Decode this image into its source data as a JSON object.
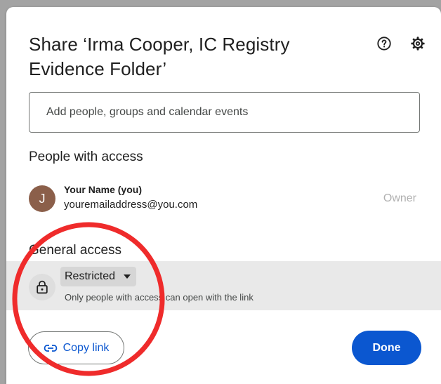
{
  "dialog": {
    "title": "Share ‘Irma Cooper, IC Registry Evidence Folder’",
    "help_icon": "help-circle-icon",
    "settings_icon": "gear-icon"
  },
  "add_people": {
    "placeholder": "Add people, groups and calendar events"
  },
  "people_with_access": {
    "heading": "People with access",
    "people": [
      {
        "avatar_letter": "J",
        "name": "Your Name (you)",
        "email": "youremailaddress@you.com",
        "role": "Owner"
      }
    ]
  },
  "general_access": {
    "heading": "General access",
    "lock_icon": "lock-icon",
    "selected": "Restricted",
    "description": "Only people with access can open with the link"
  },
  "footer": {
    "copy_link_label": "Copy link",
    "copy_link_icon": "link-icon",
    "done_label": "Done"
  },
  "colors": {
    "accent": "#0b57d0",
    "avatar": "#8b5f4a",
    "annotation": "#ef2b2b"
  }
}
